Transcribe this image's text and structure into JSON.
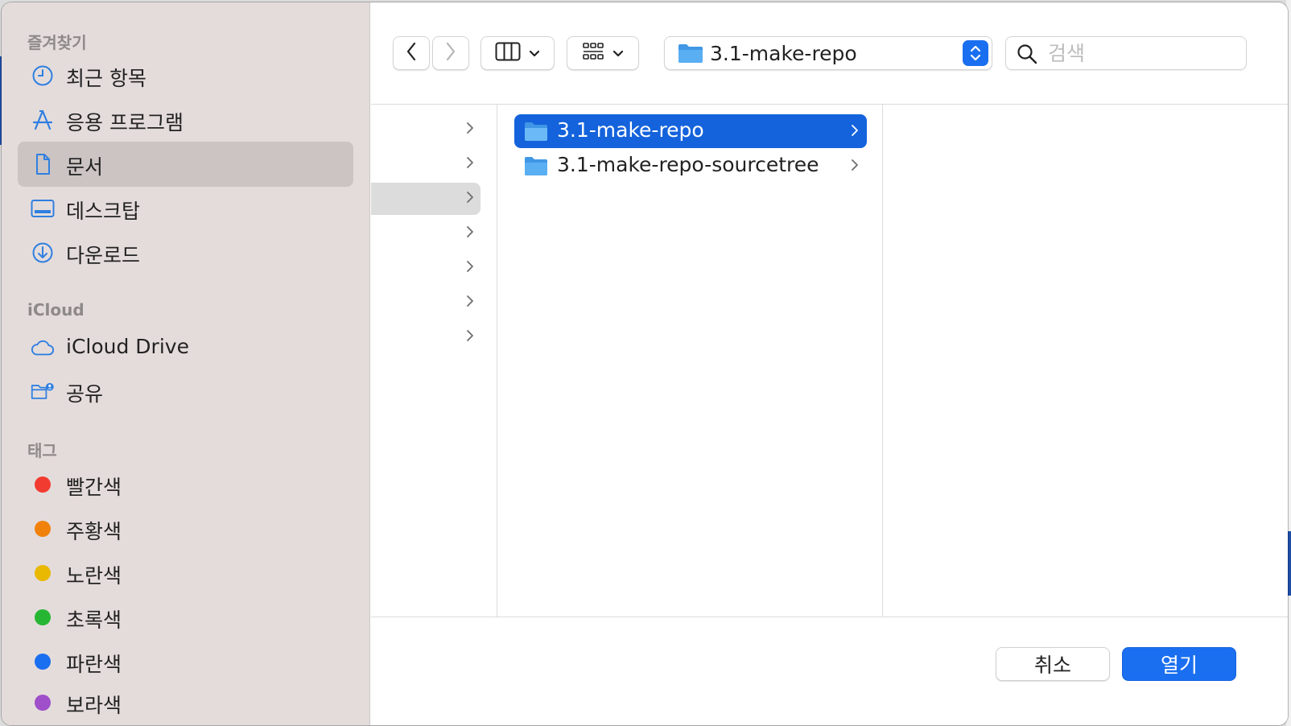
{
  "sidebar": {
    "favorites_title": "즐겨찾기",
    "favorites": [
      {
        "label": "최근 항목",
        "icon": "clock-icon"
      },
      {
        "label": "응용 프로그램",
        "icon": "applications-icon"
      },
      {
        "label": "문서",
        "icon": "document-icon",
        "selected": true
      },
      {
        "label": "데스크탑",
        "icon": "desktop-icon"
      },
      {
        "label": "다운로드",
        "icon": "download-icon"
      }
    ],
    "icloud_title": "iCloud",
    "icloud": [
      {
        "label": "iCloud Drive",
        "icon": "cloud-icon"
      },
      {
        "label": "공유",
        "icon": "shared-folder-icon"
      }
    ],
    "tags_title": "태그",
    "tags": [
      {
        "label": "빨간색",
        "color": "#f23b30"
      },
      {
        "label": "주황색",
        "color": "#f0820c"
      },
      {
        "label": "노란색",
        "color": "#e9b800"
      },
      {
        "label": "초록색",
        "color": "#27b634"
      },
      {
        "label": "파란색",
        "color": "#1a6ff0"
      },
      {
        "label": "보라색",
        "color": "#9e4fc9"
      }
    ]
  },
  "toolbar": {
    "path": "3.1-make-repo",
    "search_placeholder": "검색"
  },
  "browser": {
    "column2": [
      {
        "label": "3.1-make-repo",
        "selected": true
      },
      {
        "label": "3.1-make-repo-sourcetree",
        "selected": false
      }
    ]
  },
  "footer": {
    "cancel_label": "취소",
    "open_label": "열기"
  },
  "colors": {
    "accent": "#1a6ff0",
    "selection": "#1463dc",
    "folder": "#5aaef2"
  }
}
